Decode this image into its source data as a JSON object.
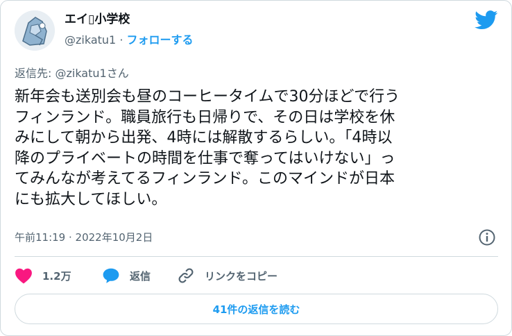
{
  "colors": {
    "accent": "#1d9bf0",
    "like": "#f91880",
    "muted": "#536471",
    "text": "#0f1419"
  },
  "author": {
    "display_name": "エイ▯小学校",
    "handle": "@zikatu1",
    "separator": "·",
    "follow_label": "フォローする"
  },
  "tweet": {
    "reply_to": "返信先: @zikatu1さん",
    "text": "新年会も送別会も昼のコーヒータイムで30分ほどで行う\nフィンランド。職員旅行も日帰りで、その日は学校を休\nみにして朝から出発、4時には解散するらしい。「4時以\n降のプライベートの時間を仕事で奪ってはいけない」っ\nてみんなが考えてるフィンランド。このマインドが日本\nにも拡大してほしい。",
    "timestamp": "午前11:19 · 2022年10月2日"
  },
  "actions": {
    "like_count": "1.2万",
    "reply_label": "返信",
    "copy_link_label": "リンクをコピー"
  },
  "read_replies_label": "41件の返信を読む",
  "icons": [
    "avatar",
    "twitter-bird-icon",
    "info-icon",
    "heart-icon",
    "speech-bubble-icon",
    "link-icon"
  ]
}
